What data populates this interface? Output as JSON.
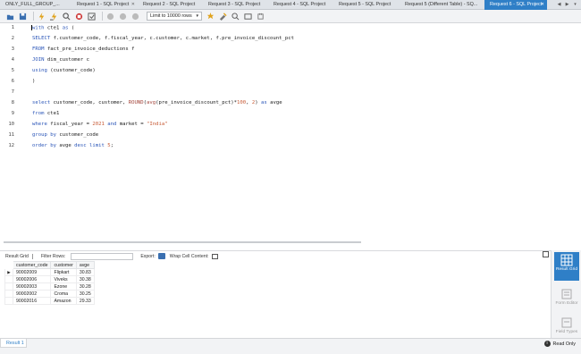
{
  "tabs": [
    {
      "label": "ONLY_FULL_GROUP_...",
      "active": false
    },
    {
      "label": "Request 1 - SQL Project",
      "active": false
    },
    {
      "label": "Request 2 - SQL Project",
      "active": false
    },
    {
      "label": "Request 3 - SQL Project",
      "active": false
    },
    {
      "label": "Request 4 - SQL Project",
      "active": false
    },
    {
      "label": "Request 5 - SQL Project",
      "active": false
    },
    {
      "label": "Request 5 (Different Table) - SQ...",
      "active": false
    },
    {
      "label": "Request 6 - SQL Project",
      "active": true
    }
  ],
  "toolbar": {
    "limit_label": "Limit to 10000 rows"
  },
  "editor": {
    "line_numbers": [
      "1",
      "2",
      "3",
      "4",
      "5",
      "6",
      "7",
      "8",
      "9",
      "10",
      "11",
      "12"
    ]
  },
  "result_toolbar": {
    "result_grid_label": "Result Grid",
    "filter_rows_label": "Filter Rows:",
    "export_label": "Export:",
    "wrap_label": "Wrap Cell Content:"
  },
  "grid": {
    "columns": [
      "customer_code",
      "customer",
      "avge"
    ],
    "rows": [
      [
        "90002009",
        "Flipkart",
        "30.83"
      ],
      [
        "90002006",
        "Viveks",
        "30.38"
      ],
      [
        "90002003",
        "Ezone",
        "30.28"
      ],
      [
        "90002002",
        "Croma",
        "30.25"
      ],
      [
        "90002016",
        "Amazon",
        "29.33"
      ]
    ]
  },
  "side_panel": {
    "result_grid": "Result Grid",
    "form_editor": "Form Editor",
    "field_types": "Field Types"
  },
  "status": {
    "result_tab": "Result 1",
    "read_only": "Read Only"
  },
  "colors": {
    "accent": "#2f7fc7",
    "keyword": "#2a55b8",
    "string": "#c75a35"
  }
}
